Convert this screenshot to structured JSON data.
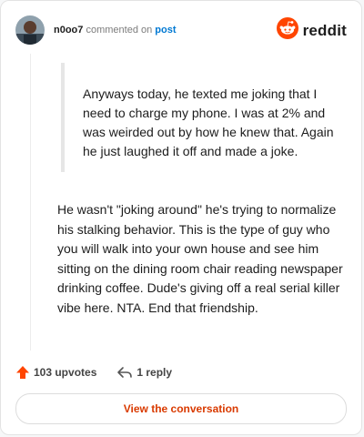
{
  "header": {
    "username": "n0oo7",
    "commented_text": "commented on",
    "post_link": "post",
    "brand": "reddit"
  },
  "quote": {
    "text": "Anyways today, he texted me joking that I need to charge my phone. I was at 2% and was weirded out by how he knew that. Again he just laughed it off and made a joke."
  },
  "comment": {
    "text": "He wasn't \"joking around\" he's trying to normalize his stalking behavior. This is the type of guy who you will walk into your own house and see him sitting on the dining room chair reading newspaper drinking coffee. Dude's giving off a real serial killer vibe here. NTA. End that friendship."
  },
  "actions": {
    "upvotes": "103 upvotes",
    "replies": "1 reply"
  },
  "cta": {
    "label": "View the conversation"
  },
  "colors": {
    "brand_orange": "#ff4500",
    "link_blue": "#0079d3",
    "cta_text": "#d93a00"
  },
  "icons": {
    "avatar": "avatar",
    "brand": "reddit-logo-icon",
    "upvote": "upvote-arrow-icon",
    "reply": "reply-arrow-icon"
  }
}
